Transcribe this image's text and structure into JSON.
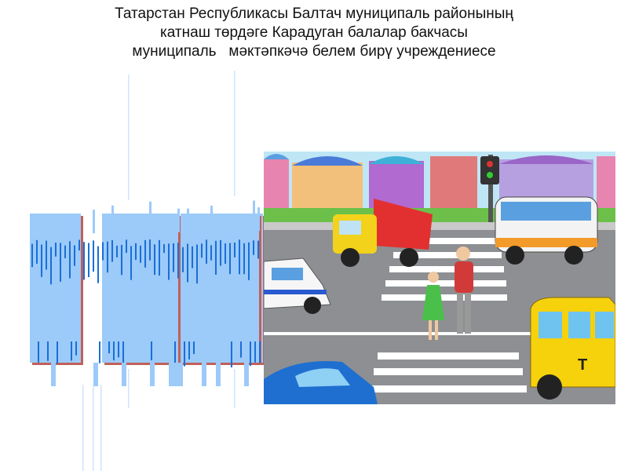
{
  "title": {
    "line1": "Татарстан Республикасы Балтач муниципаль районының",
    "line2": "катнаш төрдәге Карадуган балалар бакчасы",
    "line3": "муниципаль   мәктәпкәчә белем бирү учреждениесе"
  },
  "illustration": {
    "taxi_letter": "T",
    "colors": {
      "road": "#8d8f93",
      "wordart_fill": "#9ccaf9",
      "wordart_dark": "#1a6fd6",
      "wordart_shadow": "#c0605a",
      "taxi": "#f5d20c"
    }
  }
}
